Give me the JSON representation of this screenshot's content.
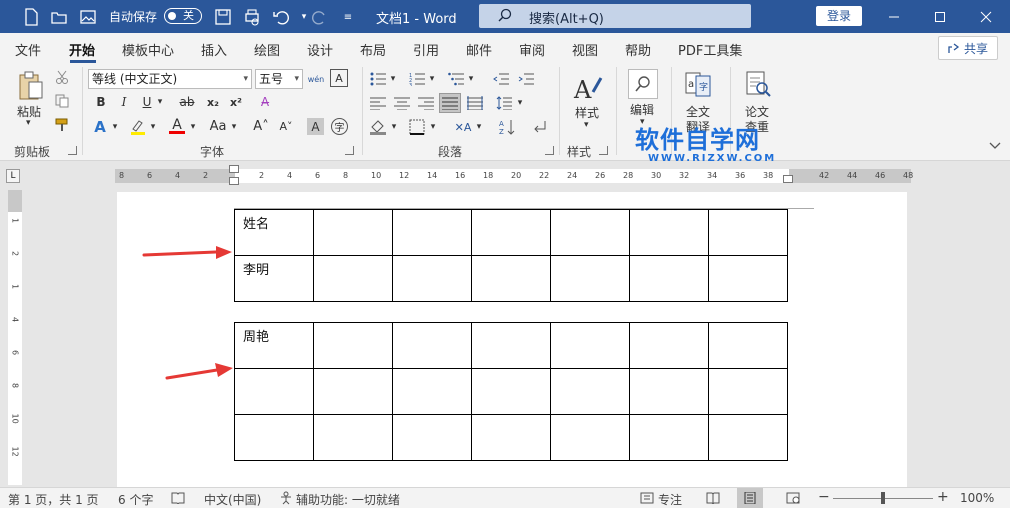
{
  "titlebar": {
    "autosave_label": "自动保存",
    "autosave_state": "关",
    "doc_title": "文档1  -  Word",
    "search_placeholder": "搜索(Alt+Q)",
    "login_label": "登录"
  },
  "tabs": [
    "文件",
    "开始",
    "模板中心",
    "插入",
    "绘图",
    "设计",
    "布局",
    "引用",
    "邮件",
    "审阅",
    "视图",
    "帮助",
    "PDF工具集"
  ],
  "active_tab": "开始",
  "share_label": "共享",
  "ribbon": {
    "paste_label": "粘贴",
    "clipboard_group": "剪贴板",
    "font_name": "等线 (中文正文)",
    "font_size": "五号",
    "font_group": "字体",
    "paragraph_group": "段落",
    "styles_label": "样式",
    "styles_group": "样式",
    "edit_label": "编辑",
    "translate_label_1": "全文",
    "translate_label_2": "翻译",
    "paper_label_1": "论文",
    "paper_label_2": "查重"
  },
  "watermark": {
    "text": "软件自学网",
    "sub": "WWW.RJZXW.COM"
  },
  "ruler": {
    "ticks": [
      "8",
      "6",
      "4",
      "2",
      "",
      "2",
      "4",
      "6",
      "8",
      "10",
      "12",
      "14",
      "16",
      "18",
      "20",
      "22",
      "24",
      "26",
      "28",
      "30",
      "32",
      "34",
      "36",
      "38",
      "",
      "42",
      "44",
      "46",
      "48"
    ],
    "v_ticks": [
      "1",
      "2",
      "1",
      "4",
      "6",
      "8",
      "10",
      "12"
    ]
  },
  "tables": [
    {
      "rows": [
        [
          "姓名",
          "",
          "",
          "",
          "",
          "",
          ""
        ],
        [
          "李明",
          "",
          "",
          "",
          "",
          "",
          ""
        ]
      ]
    },
    {
      "rows": [
        [
          "周艳",
          "",
          "",
          "",
          "",
          "",
          ""
        ],
        [
          "",
          "",
          "",
          "",
          "",
          "",
          ""
        ],
        [
          "",
          "",
          "",
          "",
          "",
          "",
          ""
        ]
      ]
    }
  ],
  "statusbar": {
    "page_info": "第 1 页，共 1 页",
    "word_count": "6 个字",
    "language": "中文(中国)",
    "accessibility": "辅助功能: 一切就绪",
    "focus_label": "专注",
    "zoom_level": "100%"
  },
  "colors": {
    "title_bar": "#2b579a",
    "arrow": "#e53935",
    "watermark": "#1e6fd9"
  }
}
